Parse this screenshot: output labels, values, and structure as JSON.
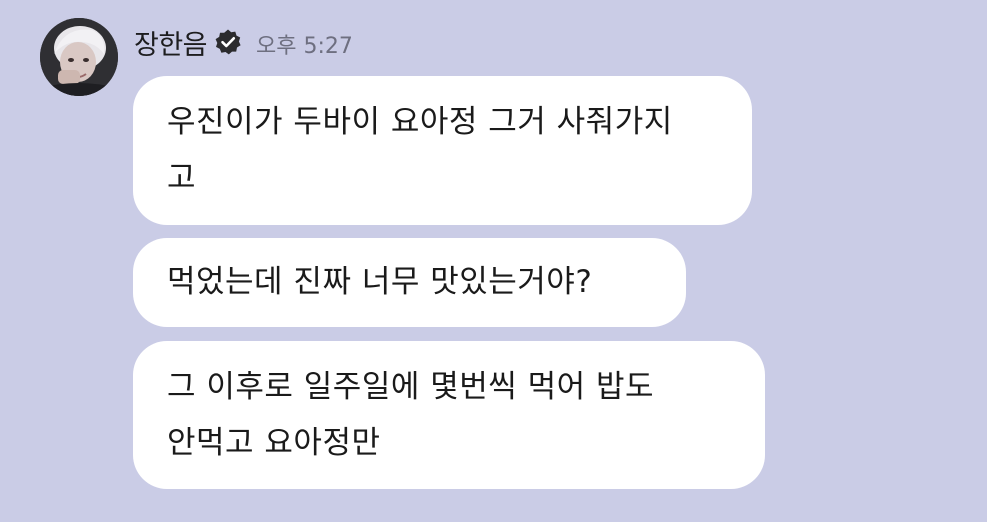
{
  "sender": {
    "name": "장한음",
    "time": "오후 5:27",
    "verified_icon": "verified-check-icon",
    "avatar_icon": "profile-photo"
  },
  "colors": {
    "background": "#cacce6",
    "bubble": "#ffffff",
    "text": "#1a1a1a",
    "timestamp": "#6e6f80"
  },
  "messages": [
    {
      "lines": [
        "우진이가 두바이 요아정 그거 사줘가지",
        "고"
      ]
    },
    {
      "lines": [
        "먹었는데 진짜 너무 맛있는거야?"
      ]
    },
    {
      "lines": [
        "그 이후로 일주일에 몇번씩 먹어 밥도",
        "안먹고 요아정만"
      ]
    }
  ]
}
